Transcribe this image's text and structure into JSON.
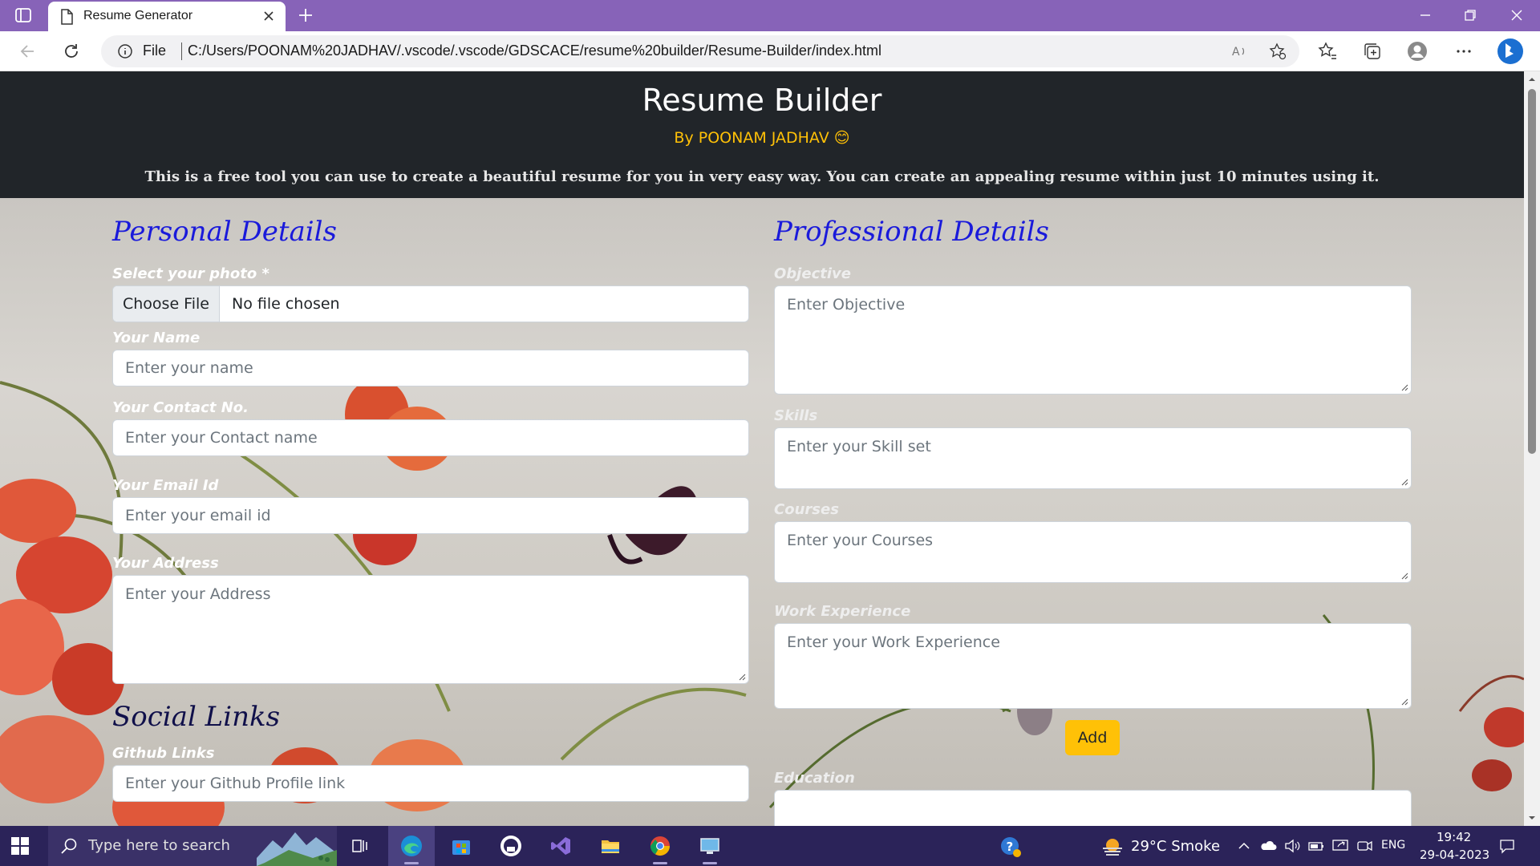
{
  "browser": {
    "tab_title": "Resume Generator",
    "url_scheme": "File",
    "url": "C:/Users/POONAM%20JADHAV/.vscode/.vscode/GDSCACE/resume%20builder/Resume-Builder/index.html"
  },
  "header": {
    "title": "Resume Builder",
    "byline": "By POONAM JADHAV 😊",
    "tagline": "This is a free tool you can use to create a beautiful resume for you in very easy way. You can create an appealing resume within just 10 minutes using it."
  },
  "personal": {
    "section_title": "Personal Details",
    "photo_label": "Select your photo *",
    "choose_file": "Choose File",
    "no_file": "No file chosen",
    "name_label": "Your Name",
    "name_placeholder": "Enter your name",
    "contact_label": "Your Contact No.",
    "contact_placeholder": "Enter your Contact name",
    "email_label": "Your Email Id",
    "email_placeholder": "Enter your email id",
    "address_label": "Your Address",
    "address_placeholder": "Enter your Address"
  },
  "social": {
    "section_title": "Social Links",
    "github_label": "Github Links",
    "github_placeholder": "Enter your Github Profile link"
  },
  "professional": {
    "section_title": "Professional Details",
    "objective_label": "Objective",
    "objective_placeholder": "Enter  Objective",
    "skills_label": "Skills",
    "skills_placeholder": "Enter your Skill set",
    "courses_label": "Courses",
    "courses_placeholder": "Enter your Courses",
    "work_label": "Work Experience",
    "work_placeholder": "Enter your Work Experience",
    "add_button": "Add",
    "education_label": "Education"
  },
  "taskbar": {
    "search_placeholder": "Type here to search",
    "weather": "29°C  Smoke",
    "language": "ENG",
    "time": "19:42",
    "date": "29-04-2023"
  },
  "colors": {
    "tabbar": "#8763b8",
    "header_bg": "#212529",
    "byline": "#ffc107",
    "section_title": "#1a1adb",
    "add_button": "#ffc107",
    "taskbar": "#2b2359"
  }
}
